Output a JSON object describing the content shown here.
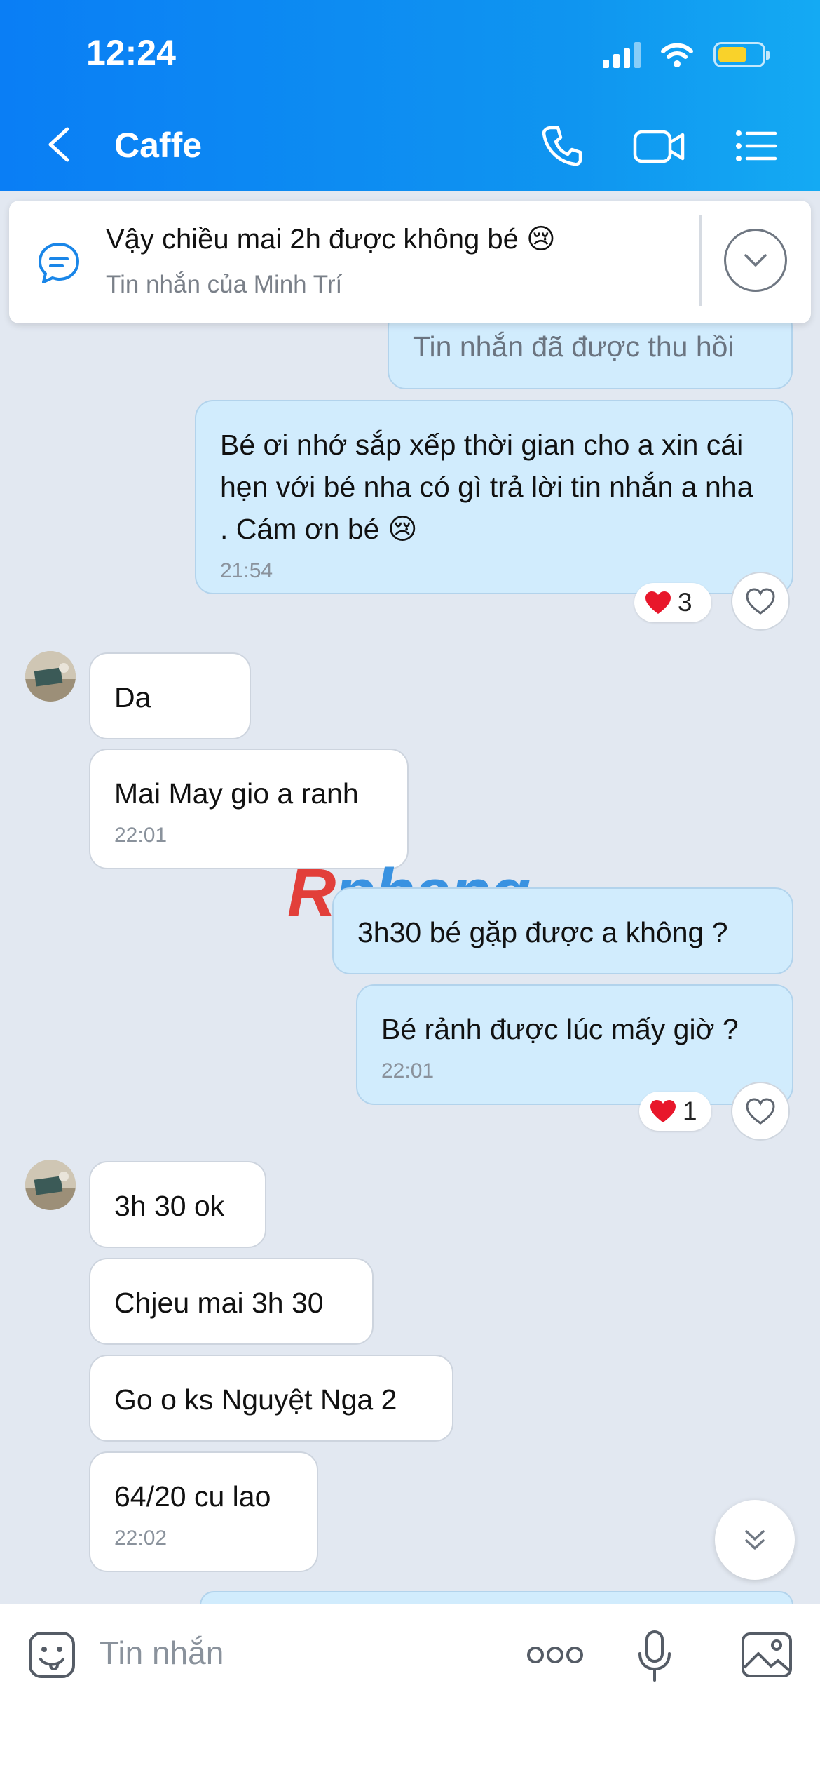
{
  "status_bar": {
    "time": "12:24"
  },
  "nav": {
    "title": "Caffe"
  },
  "pinned": {
    "text": "Vậy chiều mai 2h được không bé 😢",
    "sub": "Tin nhắn của Minh Trí"
  },
  "messages": [
    {
      "id": "m1",
      "side": "out",
      "text": "Tin nhắn đã được thu hồi"
    },
    {
      "id": "m2",
      "side": "out",
      "text": "Bé ơi nhớ sắp xếp thời gian cho a xin cái hẹn với bé nha có gì trả lời tin nhắn a nha . Cám ơn bé 😢",
      "time": "21:54",
      "reaction_count": "3"
    },
    {
      "id": "m3",
      "side": "in",
      "text": "Da"
    },
    {
      "id": "m4",
      "side": "in",
      "text": "Mai May gio a ranh",
      "time": "22:01"
    },
    {
      "id": "m5",
      "side": "out",
      "text": "3h30 bé gặp được a không ?"
    },
    {
      "id": "m6",
      "side": "out",
      "text": "Bé rảnh được lúc mấy giờ ?",
      "time": "22:01",
      "reaction_count": "1"
    },
    {
      "id": "m7",
      "side": "in",
      "text": "3h 30 ok"
    },
    {
      "id": "m8",
      "side": "in",
      "text": "Chjeu mai 3h 30"
    },
    {
      "id": "m9",
      "side": "in",
      "text": "Go o ks Nguyệt Nga 2"
    },
    {
      "id": "m10",
      "side": "in",
      "text": "64/20 cu lao",
      "time": "22:02"
    }
  ],
  "watermark": {
    "first": "R",
    "rest": "phang"
  },
  "composer": {
    "placeholder": "Tin nhắn"
  },
  "icons": {
    "back": "chevron-left-icon",
    "call": "phone-icon",
    "video": "video-camera-icon",
    "menu": "list-icon",
    "pin": "chat-bubble-icon",
    "collapse": "chevron-down-icon",
    "heart": "heart-icon",
    "scroll": "double-chevron-down-icon",
    "emoji": "sticker-icon",
    "more": "more-dots-icon",
    "mic": "microphone-icon",
    "image": "image-icon"
  },
  "colors": {
    "header": "#0f8ff2",
    "out_bubble": "#d1ecfd",
    "in_bubble": "#ffffff",
    "background": "#e2e8f1",
    "heart": "#e8172b"
  }
}
